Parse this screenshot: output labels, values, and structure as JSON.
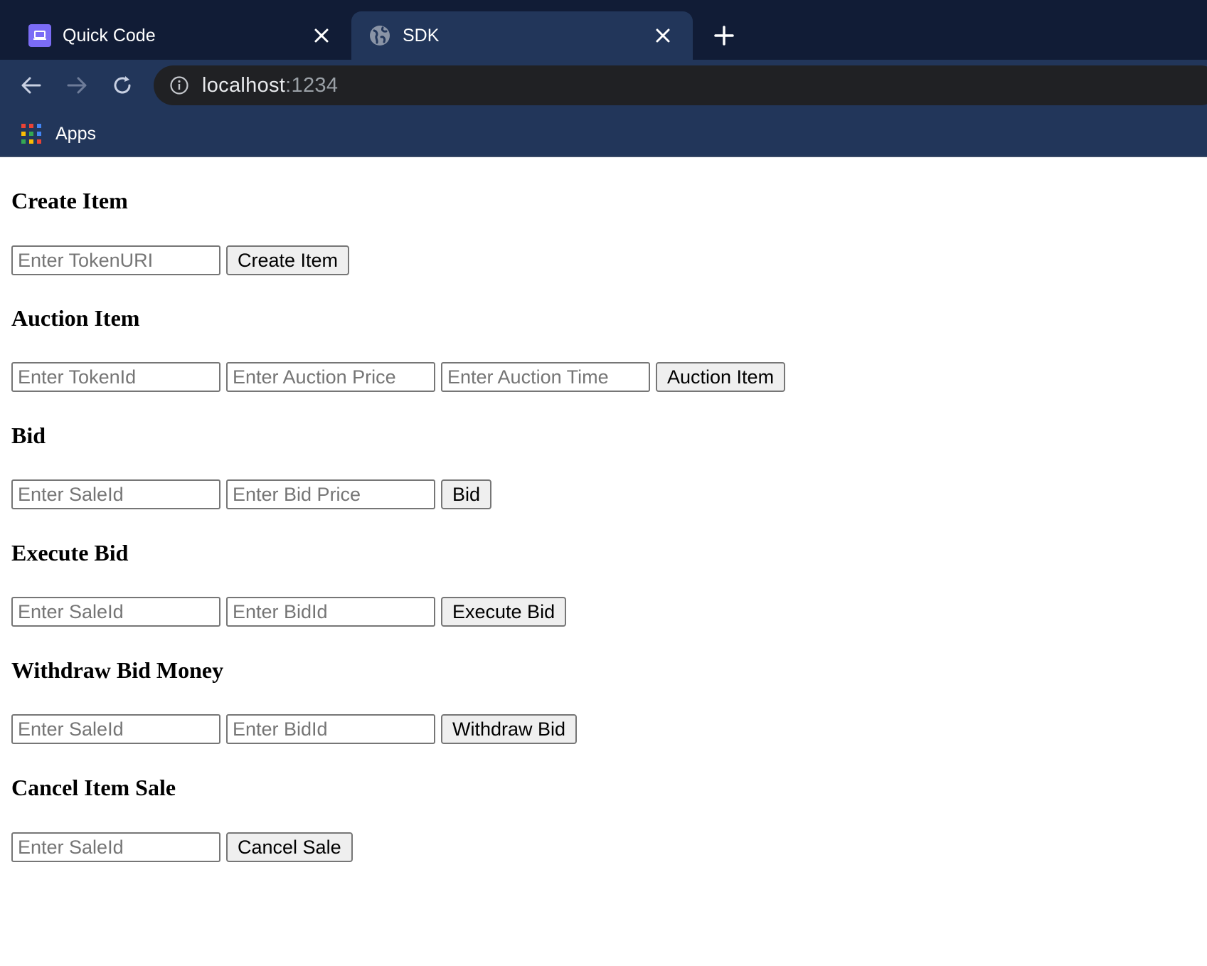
{
  "browser": {
    "tabs": [
      {
        "title": "Quick Code",
        "favicon": "laptop-icon",
        "active": false
      },
      {
        "title": "SDK",
        "favicon": "globe-icon",
        "active": true
      }
    ],
    "address_host": "localhost",
    "address_port": ":1234",
    "bookmarks": {
      "apps_label": "Apps"
    },
    "colors": {
      "tabstrip": "#111c36",
      "toolbar": "#22365a",
      "omnibox": "#202124"
    }
  },
  "sections": {
    "create": {
      "title": "Create Item",
      "inputs": [
        "Enter TokenURI"
      ],
      "button": "Create Item"
    },
    "auction": {
      "title": "Auction Item",
      "inputs": [
        "Enter TokenId",
        "Enter Auction Price",
        "Enter Auction Time"
      ],
      "button": "Auction Item"
    },
    "bid": {
      "title": "Bid",
      "inputs": [
        "Enter SaleId",
        "Enter Bid Price"
      ],
      "button": "Bid"
    },
    "execute": {
      "title": "Execute Bid",
      "inputs": [
        "Enter SaleId",
        "Enter BidId"
      ],
      "button": "Execute Bid"
    },
    "withdraw": {
      "title": "Withdraw Bid Money",
      "inputs": [
        "Enter SaleId",
        "Enter BidId"
      ],
      "button": "Withdraw Bid"
    },
    "cancel": {
      "title": "Cancel Item Sale",
      "inputs": [
        "Enter SaleId"
      ],
      "button": "Cancel Sale"
    }
  }
}
